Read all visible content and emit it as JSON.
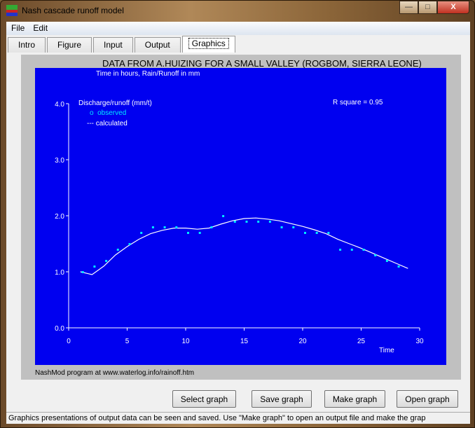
{
  "window": {
    "title": "Nash cascade runoff model",
    "controls": [
      "minimize",
      "maximize",
      "close"
    ]
  },
  "menu": [
    "File",
    "Edit"
  ],
  "tabs": [
    {
      "label": "Intro"
    },
    {
      "label": "Figure"
    },
    {
      "label": "Input"
    },
    {
      "label": "Output"
    },
    {
      "label": "Graphics",
      "active": true
    }
  ],
  "graphic": {
    "title": "DATA FROM A.HUIZING FOR A SMALL VALLEY (ROGBOM, SIERRA LEONE)",
    "subtitle": "Time in hours, Rain/Runoff in mm",
    "footer": "NashMod program at www.waterlog.info/rainoff.htm"
  },
  "chart_data": {
    "type": "scatter",
    "ylabel": "Discharge/runoff (mm/t)",
    "xlabel": "Time",
    "annotation": "R square = 0.95",
    "xlim": [
      0,
      30
    ],
    "ylim": [
      0,
      4
    ],
    "xticks": [
      "0",
      "5",
      "10",
      "15",
      "20",
      "25",
      "30"
    ],
    "yticks": [
      "0.0",
      "1.0",
      "2.0",
      "3.0",
      "4.0"
    ],
    "background": "#0000f0",
    "series": [
      {
        "name": "observed",
        "legend": "o  observed",
        "color": "#00e8ff",
        "marker": "square",
        "x": [
          1,
          2,
          3,
          4,
          5,
          6,
          7,
          8,
          9,
          10,
          11,
          12,
          13,
          14,
          15,
          16,
          17,
          18,
          19,
          20,
          21,
          22,
          23,
          24,
          25,
          26,
          27,
          28
        ],
        "y": [
          1.0,
          1.1,
          1.2,
          1.4,
          1.5,
          1.7,
          1.8,
          1.8,
          1.8,
          1.7,
          1.7,
          1.8,
          2.0,
          1.9,
          1.9,
          1.9,
          1.9,
          1.8,
          1.8,
          1.7,
          1.7,
          1.7,
          1.4,
          1.4,
          1.4,
          1.3,
          1.2,
          1.1
        ]
      },
      {
        "name": "calculated",
        "legend": "--- calculated",
        "color": "#ffffff",
        "line": true,
        "x": [
          1,
          2,
          3,
          4,
          5,
          6,
          7,
          8,
          9,
          10,
          11,
          12,
          13,
          14,
          15,
          16,
          17,
          18,
          19,
          20,
          21,
          22,
          23,
          24,
          25,
          26,
          27,
          28,
          29
        ],
        "y": [
          1.0,
          0.95,
          1.1,
          1.3,
          1.45,
          1.58,
          1.68,
          1.74,
          1.78,
          1.78,
          1.76,
          1.78,
          1.85,
          1.91,
          1.95,
          1.96,
          1.94,
          1.91,
          1.86,
          1.81,
          1.75,
          1.68,
          1.58,
          1.5,
          1.42,
          1.33,
          1.24,
          1.15,
          1.06
        ]
      }
    ]
  },
  "buttons": {
    "select": "Select graph",
    "save": "Save graph",
    "make": "Make graph",
    "open": "Open graph"
  },
  "status": "Graphics presentations of output data can be seen and saved. Use \"Make graph\" to open an output file and make the grap"
}
